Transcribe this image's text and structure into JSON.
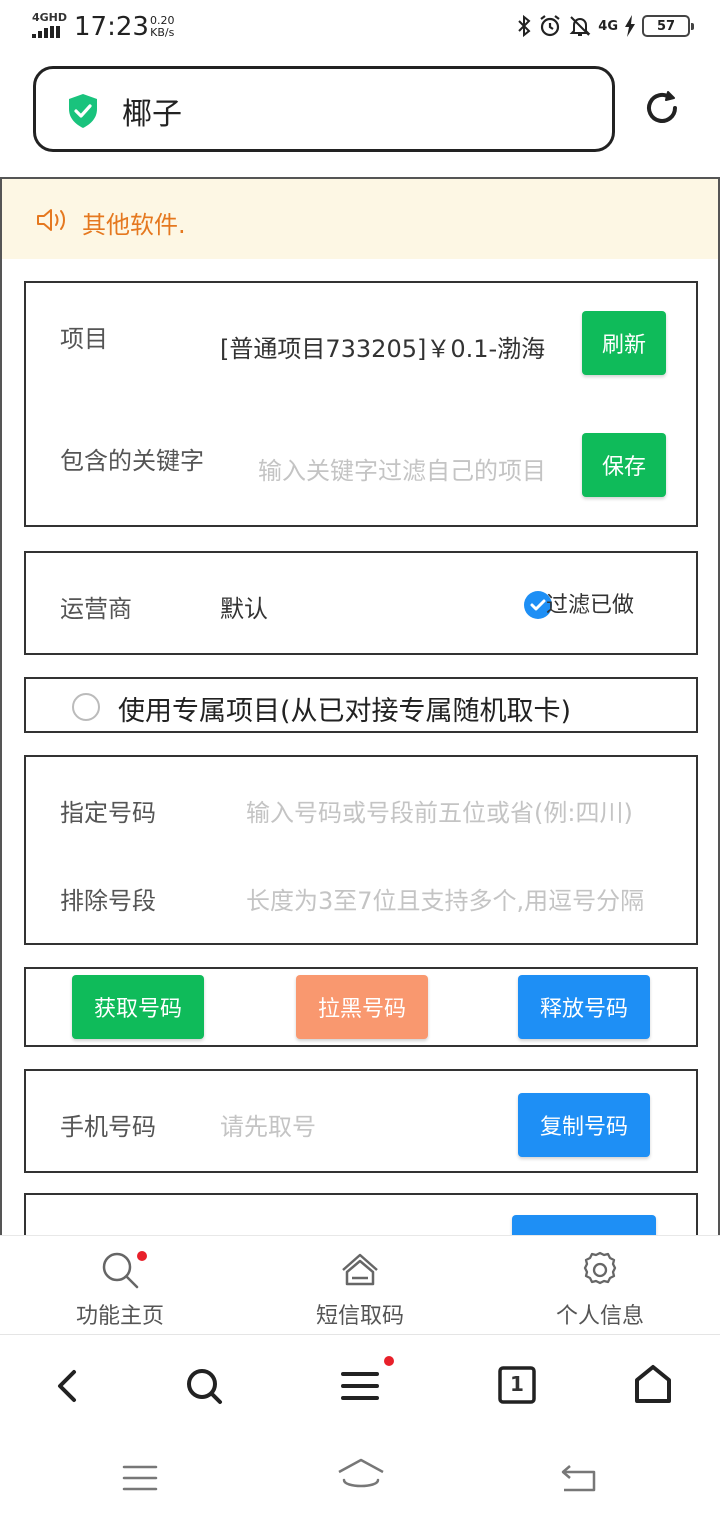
{
  "status": {
    "network": "4GHD",
    "time": "17:23",
    "speed_value": "0.20",
    "speed_unit": "KB/s",
    "network_right": "4G",
    "battery": "57"
  },
  "address": {
    "query": "椰子",
    "secure_color": "#19c37d"
  },
  "notice": {
    "text": "其他软件."
  },
  "project": {
    "label": "项目",
    "value": "[普通项目733205]￥0.1-渤海",
    "refresh_label": "刷新",
    "keyword_label": "包含的关键字",
    "keyword_placeholder": "输入关键字过滤自己的项目",
    "save_label": "保存"
  },
  "carrier": {
    "label": "运营商",
    "value": "默认",
    "filter_label": "过滤已做",
    "filter_checked": true
  },
  "exclusive": {
    "label": "使用专属项目(从已对接专属随机取卡)",
    "checked": false
  },
  "number": {
    "designated_label": "指定号码",
    "designated_placeholder": "输入号码或号段前五位或省(例:四川)",
    "exclude_label": "排除号段",
    "exclude_placeholder": "长度为3至7位且支持多个,用逗号分隔"
  },
  "actions": {
    "get_label": "获取号码",
    "block_label": "拉黑号码",
    "release_label": "释放号码"
  },
  "phone": {
    "label": "手机号码",
    "placeholder": "请先取号",
    "copy_label": "复制号码"
  },
  "tabs": {
    "home": "功能主页",
    "sms": "短信取码",
    "profile": "个人信息"
  },
  "browser": {
    "tab_count": "1"
  },
  "colors": {
    "green": "#0fbb5a",
    "orange": "#f9986f",
    "blue": "#1e8ff5",
    "notice_text": "#e5781f",
    "notice_bg": "#fdf7e4",
    "badge": "#e8202a"
  }
}
